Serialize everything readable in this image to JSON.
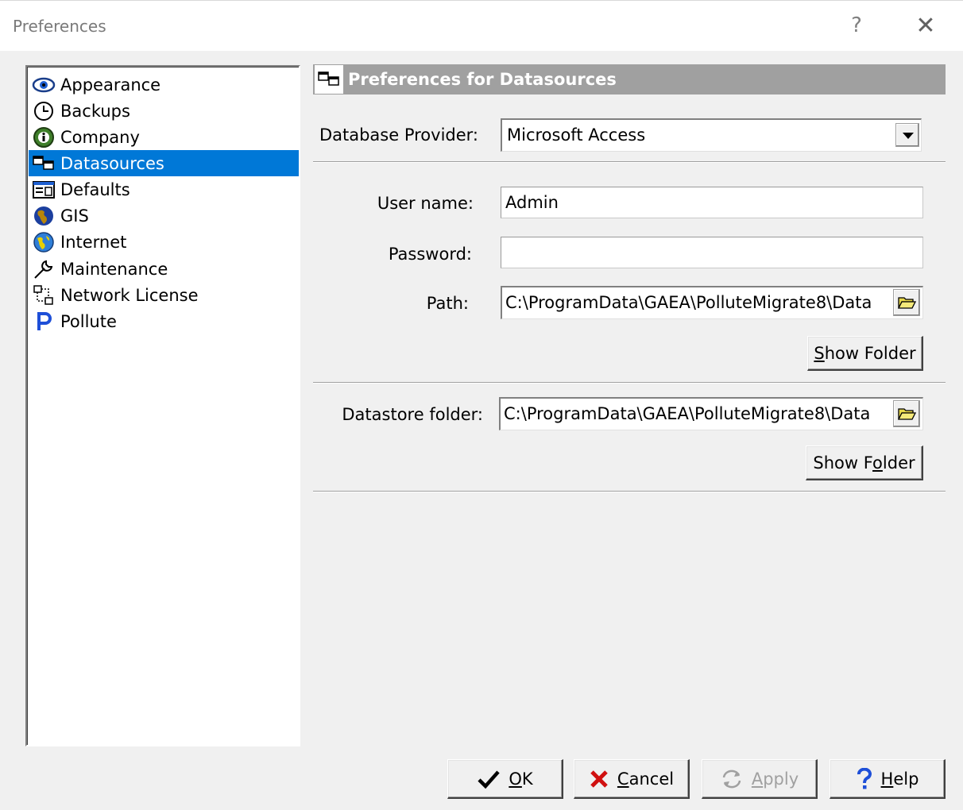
{
  "window": {
    "title": "Preferences",
    "help_glyph": "?",
    "close_glyph": "✕"
  },
  "tree": {
    "items": [
      {
        "label": "Appearance",
        "icon": "eye-icon"
      },
      {
        "label": "Backups",
        "icon": "clock-icon"
      },
      {
        "label": "Company",
        "icon": "info-icon"
      },
      {
        "label": "Datasources",
        "icon": "datasources-icon",
        "selected": true
      },
      {
        "label": "Defaults",
        "icon": "defaults-icon"
      },
      {
        "label": "GIS",
        "icon": "globe-icon"
      },
      {
        "label": "Internet",
        "icon": "internet-globe-icon"
      },
      {
        "label": "Maintenance",
        "icon": "wrench-icon"
      },
      {
        "label": "Network License",
        "icon": "network-icon"
      },
      {
        "label": "Pollute",
        "icon": "pollute-p-icon"
      }
    ]
  },
  "panel": {
    "title": "Preferences for Datasources"
  },
  "form": {
    "provider_label": "Database Provider:",
    "provider_value": "Microsoft Access",
    "username_label": "User name:",
    "username_value": "Admin",
    "password_label": "Password:",
    "password_value": "",
    "path_label": "Path:",
    "path_value": "C:\\ProgramData\\GAEA\\PolluteMigrate8\\Data",
    "show_folder_1_pre": "S",
    "show_folder_1_post": "how Folder",
    "datastore_label": "Datastore folder:",
    "datastore_value": "C:\\ProgramData\\GAEA\\PolluteMigrate8\\Data",
    "show_folder_2_pre": "Show F",
    "show_folder_2_u": "o",
    "show_folder_2_post": "lder"
  },
  "buttons": {
    "ok_u": "O",
    "ok_post": "K",
    "cancel_u": "C",
    "cancel_post": "ancel",
    "apply_u": "A",
    "apply_post": "pply",
    "help_u": "H",
    "help_post": "elp"
  },
  "colors": {
    "selection": "#0078d7",
    "header": "#a0a0a0"
  }
}
